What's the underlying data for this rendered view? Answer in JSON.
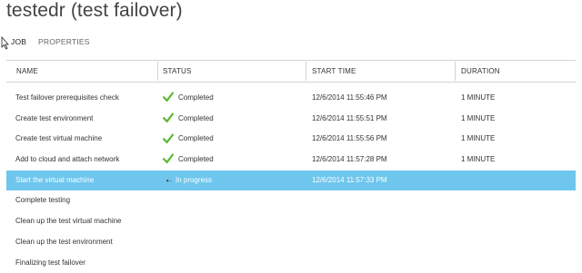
{
  "page": {
    "title": "testedr (test failover)"
  },
  "tabs": [
    {
      "label": "JOB",
      "active": true
    },
    {
      "label": "PROPERTIES",
      "active": false
    }
  ],
  "table": {
    "columns": [
      "NAME",
      "STATUS",
      "START TIME",
      "DURATION"
    ],
    "rows": [
      {
        "name": "Test failover prerequisites check",
        "status": "Completed",
        "status_icon": "check-icon",
        "start": "12/6/2014 11:55:46 PM",
        "duration": "1 MINUTE",
        "selected": false
      },
      {
        "name": "Create test environment",
        "status": "Completed",
        "status_icon": "check-icon",
        "start": "12/6/2014 11:55:51 PM",
        "duration": "1 MINUTE",
        "selected": false
      },
      {
        "name": "Create test virtual machine",
        "status": "Completed",
        "status_icon": "check-icon",
        "start": "12/6/2014 11:55:56 PM",
        "duration": "1 MINUTE",
        "selected": false
      },
      {
        "name": "Add to cloud and attach network",
        "status": "Completed",
        "status_icon": "check-icon",
        "start": "12/6/2014 11:57:28 PM",
        "duration": "1 MINUTE",
        "selected": false
      },
      {
        "name": "Start the virtual machine",
        "status": "In progress",
        "status_icon": "spinner-icon",
        "start": "12/6/2014 11:57:33 PM",
        "duration": "",
        "selected": true
      },
      {
        "name": "Complete testing",
        "status": "",
        "status_icon": "",
        "start": "",
        "duration": "",
        "selected": false
      },
      {
        "name": "Clean up the test virtual machine",
        "status": "",
        "status_icon": "",
        "start": "",
        "duration": "",
        "selected": false
      },
      {
        "name": "Clean up the test environment",
        "status": "",
        "status_icon": "",
        "start": "",
        "duration": "",
        "selected": false
      },
      {
        "name": "Finalizing test failover",
        "status": "",
        "status_icon": "",
        "start": "",
        "duration": "",
        "selected": false
      }
    ]
  },
  "colors": {
    "selected_row_bg": "#6fc6ed",
    "check_green": "#5cb833",
    "header_border": "#d4d4d4"
  }
}
